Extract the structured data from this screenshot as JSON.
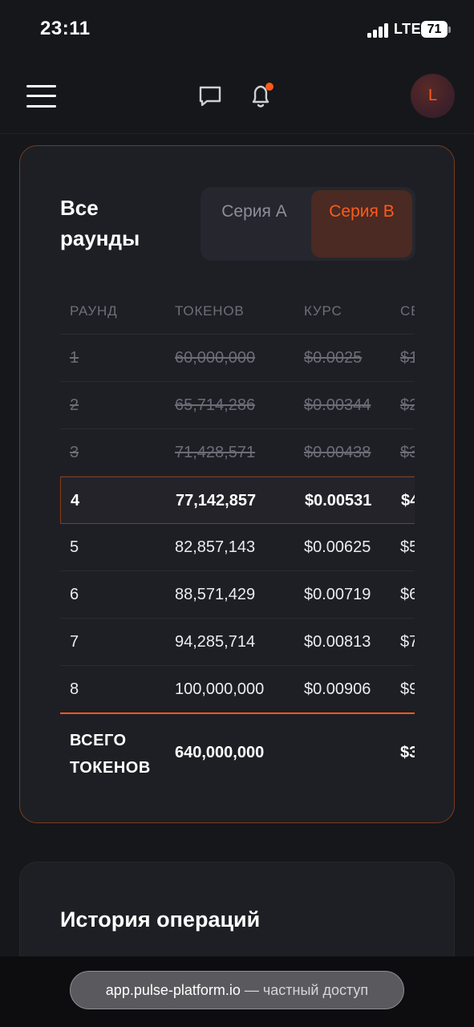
{
  "status_bar": {
    "time": "23:11",
    "network": "LTE",
    "battery": "71"
  },
  "header": {
    "menu_icon": "hamburger-menu-icon",
    "chat_icon": "chat-bubble-icon",
    "bell_icon": "bell-icon",
    "avatar_letter": "L",
    "notification_color": "#ff5a1a"
  },
  "rounds_card": {
    "title": "Все раунды",
    "series": [
      {
        "label": "Серия А",
        "active": false
      },
      {
        "label": "Серия В",
        "active": true
      }
    ],
    "columns": [
      "РАУНД",
      "ТОКЕНОВ",
      "КУРС",
      "СБ"
    ],
    "rows": [
      {
        "round": "1",
        "tokens": "60,000,000",
        "rate": "$0.0025",
        "extra": "$1",
        "state": "done"
      },
      {
        "round": "2",
        "tokens": "65,714,286",
        "rate": "$0.00344",
        "extra": "$2",
        "state": "done"
      },
      {
        "round": "3",
        "tokens": "71,428,571",
        "rate": "$0.00438",
        "extra": "$3",
        "state": "done"
      },
      {
        "round": "4",
        "tokens": "77,142,857",
        "rate": "$0.00531",
        "extra": "$4",
        "state": "active"
      },
      {
        "round": "5",
        "tokens": "82,857,143",
        "rate": "$0.00625",
        "extra": "$5",
        "state": "future"
      },
      {
        "round": "6",
        "tokens": "88,571,429",
        "rate": "$0.00719",
        "extra": "$6",
        "state": "future"
      },
      {
        "round": "7",
        "tokens": "94,285,714",
        "rate": "$0.00813",
        "extra": "$7",
        "state": "future"
      },
      {
        "round": "8",
        "tokens": "100,000,000",
        "rate": "$0.00906",
        "extra": "$9",
        "state": "future"
      }
    ],
    "total": {
      "label_line1": "ВСЕГО",
      "label_line2": "ТОКЕНОВ",
      "value": "640,000,000",
      "extra": "$3"
    },
    "accent_color": "#ff5a1a"
  },
  "history_card": {
    "title": "История операций"
  },
  "browser": {
    "domain": "app.pulse-platform.io",
    "separator": " — ",
    "note": "частный доступ"
  }
}
